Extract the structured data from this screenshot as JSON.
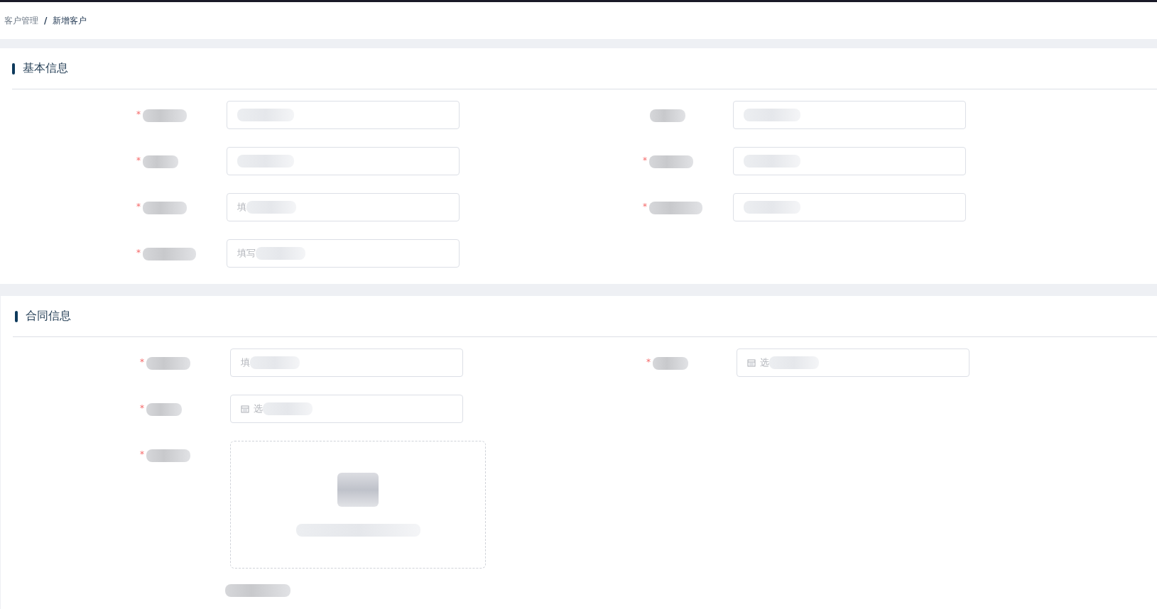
{
  "breadcrumb": {
    "separator": "/",
    "items": [
      {
        "label": "客户管理",
        "current": false
      },
      {
        "label": "新增客户",
        "current": true
      }
    ]
  },
  "sections": [
    {
      "title": "基本信息",
      "rows": [
        [
          {
            "kind": "input",
            "mark": "*"
          },
          {
            "kind": "input"
          }
        ],
        [
          {
            "kind": "input",
            "mark": "*"
          },
          {
            "kind": "input",
            "mark": "*"
          }
        ],
        [
          {
            "kind": "input",
            "mark": "*",
            "placeholder": "填"
          },
          {
            "kind": "input",
            "mark": "*"
          }
        ],
        [
          {
            "kind": "input",
            "mark": "*",
            "placeholder": "填写"
          }
        ]
      ]
    },
    {
      "title": "合同信息",
      "rows": [
        [
          {
            "kind": "input",
            "mark": "*",
            "placeholder": "填"
          },
          {
            "kind": "date",
            "mark": "*",
            "placeholder": "选"
          }
        ],
        [
          {
            "kind": "date",
            "mark": "*",
            "placeholder": "选"
          }
        ],
        [
          {
            "kind": "upload",
            "mark": "*"
          }
        ]
      ]
    }
  ]
}
